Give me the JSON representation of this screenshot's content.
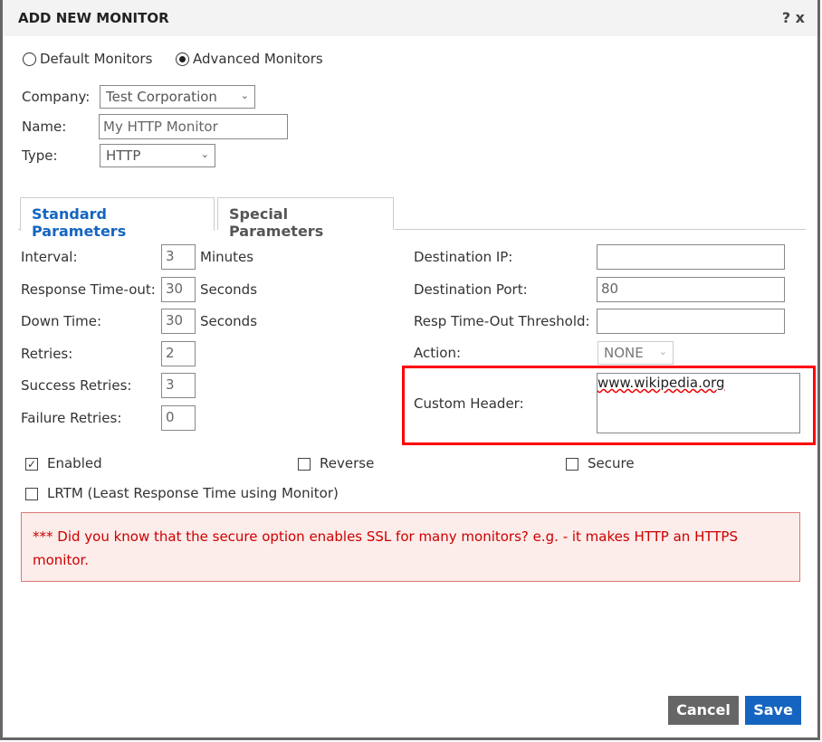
{
  "dialog": {
    "title": "ADD NEW MONITOR",
    "help_icon": "?",
    "close_icon": "x"
  },
  "mode": {
    "options": [
      "Default Monitors",
      "Advanced Monitors"
    ],
    "selected": "Advanced Monitors"
  },
  "form": {
    "company_label": "Company:",
    "company_value": "Test Corporation",
    "name_label": "Name:",
    "name_value": "My HTTP Monitor",
    "type_label": "Type:",
    "type_value": "HTTP"
  },
  "tabs": [
    {
      "label": "Standard Parameters",
      "active": true
    },
    {
      "label": "Special Parameters",
      "active": false
    }
  ],
  "left_params": [
    {
      "label": "Interval:",
      "value": "3",
      "unit": "Minutes"
    },
    {
      "label": "Response Time-out:",
      "value": "30",
      "unit": "Seconds"
    },
    {
      "label": "Down Time:",
      "value": "30",
      "unit": "Seconds"
    },
    {
      "label": "Retries:",
      "value": "2",
      "unit": ""
    },
    {
      "label": "Success Retries:",
      "value": "3",
      "unit": ""
    },
    {
      "label": "Failure Retries:",
      "value": "0",
      "unit": ""
    }
  ],
  "right_params": {
    "dest_ip_label": "Destination IP:",
    "dest_ip_value": "",
    "dest_port_label": "Destination Port:",
    "dest_port_value": "80",
    "threshold_label": "Resp Time-Out Threshold:",
    "threshold_value": "",
    "action_label": "Action:",
    "action_value": "NONE",
    "custom_header_label": "Custom Header:",
    "custom_header_value": "www.wikipedia.org"
  },
  "checkboxes": {
    "enabled": {
      "label": "Enabled",
      "checked": true
    },
    "reverse": {
      "label": "Reverse",
      "checked": false
    },
    "secure": {
      "label": "Secure",
      "checked": false
    },
    "lrtm": {
      "label": "LRTM (Least Response Time using Monitor)",
      "checked": false
    }
  },
  "tip": "*** Did you know that the secure option enables SSL for many monitors? e.g. - it makes HTTP an HTTPS monitor.",
  "buttons": {
    "cancel": "Cancel",
    "save": "Save"
  },
  "colors": {
    "accent": "#1565c0",
    "cancel_bg": "#666666",
    "highlight": "#ff0000",
    "tip_text": "#cc0000"
  }
}
